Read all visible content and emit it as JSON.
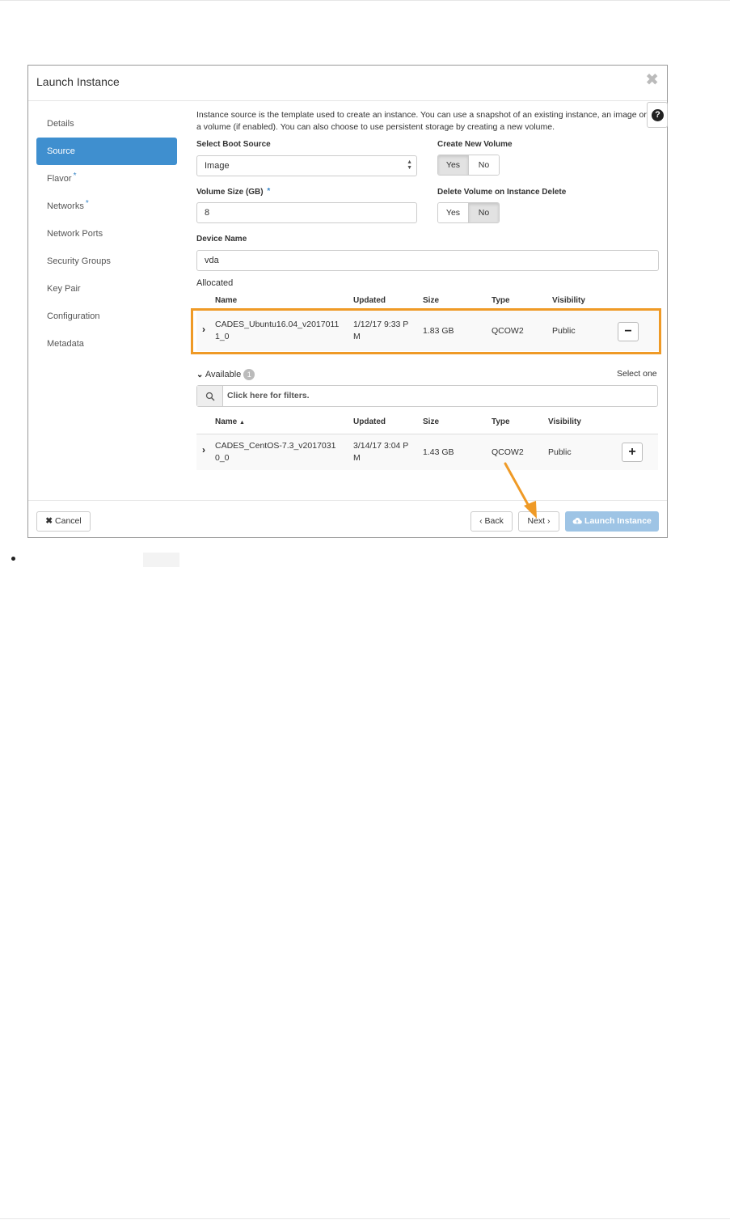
{
  "modal": {
    "title": "Launch Instance",
    "close_icon": "close-icon"
  },
  "sidebar": {
    "items": [
      {
        "label": "Details",
        "required": false
      },
      {
        "label": "Source",
        "required": false,
        "active": true
      },
      {
        "label": "Flavor",
        "required": true
      },
      {
        "label": "Networks",
        "required": true
      },
      {
        "label": "Network Ports",
        "required": false
      },
      {
        "label": "Security Groups",
        "required": false
      },
      {
        "label": "Key Pair",
        "required": false
      },
      {
        "label": "Configuration",
        "required": false
      },
      {
        "label": "Metadata",
        "required": false
      }
    ],
    "required_marker": "*"
  },
  "source": {
    "description": "Instance source is the template used to create an instance. You can use a snapshot of an existing instance, an image or a volume (if enabled). You can also choose to use persistent storage by creating a new volume.",
    "help_icon": "question-circle-icon",
    "boot_source_label": "Select Boot Source",
    "boot_source_value": "Image",
    "create_volume_label": "Create New Volume",
    "create_volume_options": [
      "Yes",
      "No"
    ],
    "create_volume_selected": "Yes",
    "volume_size_label": "Volume Size (GB)",
    "volume_size_required": "*",
    "volume_size_value": "8",
    "delete_volume_label": "Delete Volume on Instance Delete",
    "delete_volume_options": [
      "Yes",
      "No"
    ],
    "delete_volume_selected": "No",
    "device_name_label": "Device Name",
    "device_name_value": "vda"
  },
  "allocated": {
    "label": "Allocated",
    "headers": {
      "name": "Name",
      "updated": "Updated",
      "size": "Size",
      "type": "Type",
      "visibility": "Visibility"
    },
    "rows": [
      {
        "name_line1": "CADES_Ubuntu16.04_v2017011",
        "name_line2": "1_0",
        "updated_line1": "1/12/17 9:33 P",
        "updated_line2": "M",
        "size": "1.83 GB",
        "type": "QCOW2",
        "visibility": "Public",
        "action": "−"
      }
    ],
    "highlight_color": "#ef9a26"
  },
  "available": {
    "label": "Available",
    "count": "1",
    "select_hint": "Select one",
    "filter_placeholder": "Click here for filters.",
    "headers": {
      "name": "Name",
      "sort_icon": "▲",
      "updated": "Updated",
      "size": "Size",
      "type": "Type",
      "visibility": "Visibility"
    },
    "rows": [
      {
        "name_line1": "CADES_CentOS-7.3_v2017031",
        "name_line2": "0_0",
        "updated_line1": "3/14/17 3:04 P",
        "updated_line2": "M",
        "size": "1.43 GB",
        "type": "QCOW2",
        "visibility": "Public",
        "action": "+"
      }
    ]
  },
  "footer": {
    "cancel_label": "Cancel",
    "back_label": "‹ Back",
    "next_label": "Next ›",
    "launch_label": "Launch Instance",
    "annotation_arrow_color": "#ef9a26"
  }
}
